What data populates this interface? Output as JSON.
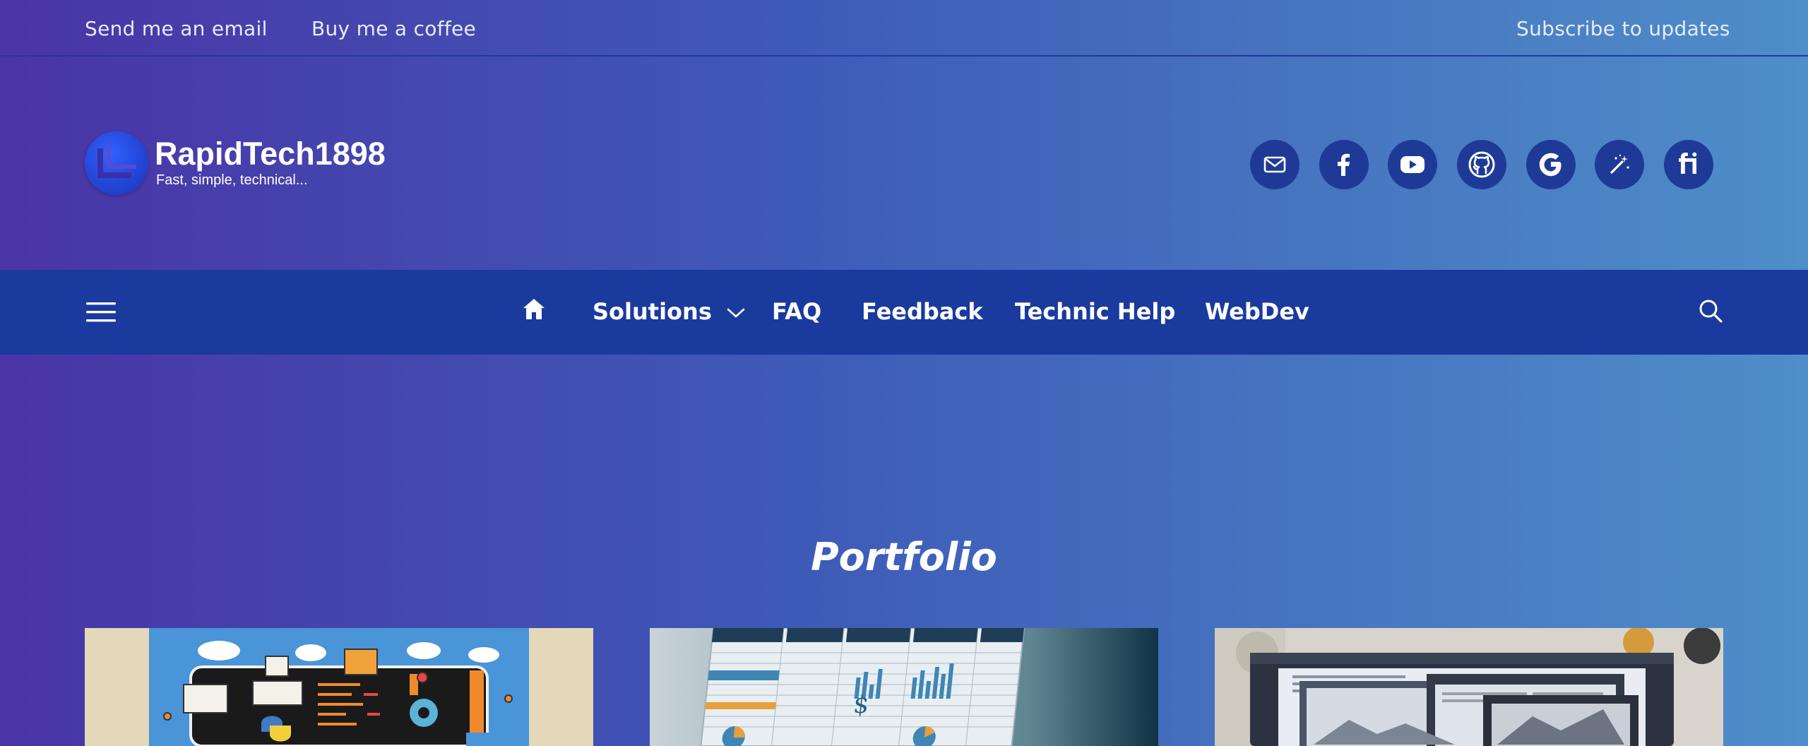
{
  "topbar": {
    "email_link": "Send me an email",
    "coffee_link": "Buy me a coffee",
    "subscribe_link": "Subscribe to updates"
  },
  "brand": {
    "title": "RapidTech1898",
    "tagline": "Fast, simple, technical..."
  },
  "social_icons": [
    "email-icon",
    "facebook-icon",
    "youtube-icon",
    "github-icon",
    "google-icon",
    "magic-wand-icon",
    "fiverr-icon"
  ],
  "nav": {
    "items": [
      {
        "label": "Solutions",
        "has_dropdown": true
      },
      {
        "label": "FAQ"
      },
      {
        "label": "Feedback"
      },
      {
        "label": "Technic Help"
      },
      {
        "label": "WebDev"
      }
    ]
  },
  "main": {
    "section_title": "Portfolio"
  },
  "colors": {
    "nav_bg": "#1a3a9e",
    "social_bg": "#1f3a96",
    "gradient_start": "#4a34a6",
    "gradient_end": "#4f8ec9"
  }
}
